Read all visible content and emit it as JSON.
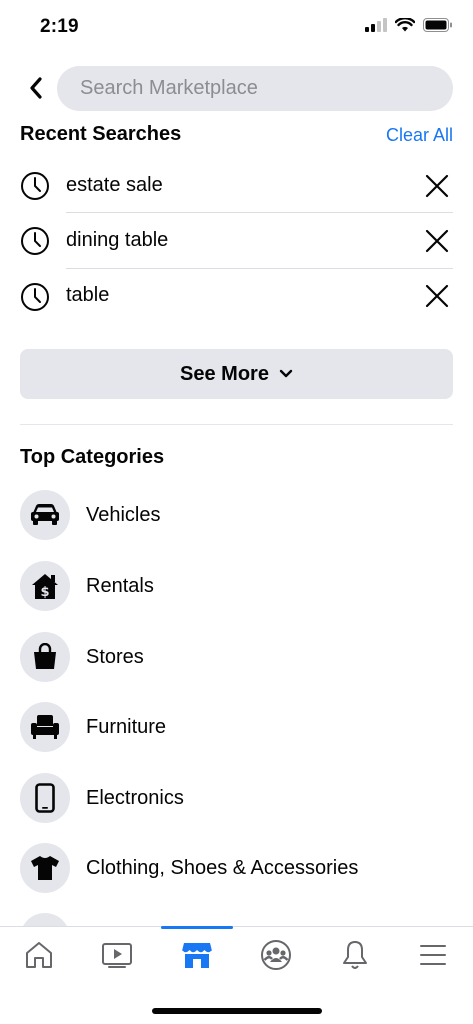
{
  "status_bar": {
    "time": "2:19"
  },
  "search": {
    "placeholder": "Search Marketplace"
  },
  "recent": {
    "title": "Recent Searches",
    "clear_label": "Clear All",
    "items": [
      {
        "label": "estate sale",
        "icon": "clock-icon"
      },
      {
        "label": "dining table",
        "icon": "clock-icon"
      },
      {
        "label": "table",
        "icon": "clock-icon"
      }
    ],
    "see_more_label": "See More"
  },
  "categories": {
    "title": "Top Categories",
    "items": [
      {
        "label": "Vehicles",
        "icon": "car-icon"
      },
      {
        "label": "Rentals",
        "icon": "house-dollar-icon"
      },
      {
        "label": "Stores",
        "icon": "shopping-bag-icon"
      },
      {
        "label": "Furniture",
        "icon": "armchair-icon"
      },
      {
        "label": "Electronics",
        "icon": "smartphone-icon"
      },
      {
        "label": "Clothing, Shoes & Accessories",
        "icon": "tshirt-icon"
      }
    ]
  },
  "bottom_nav": {
    "items": [
      "home-icon",
      "watch-icon",
      "marketplace-icon",
      "groups-icon",
      "bell-icon",
      "menu-icon"
    ],
    "active": "marketplace-icon"
  },
  "colors": {
    "accent": "#1877f2",
    "chip_bg": "#e4e6eb",
    "text": "#050505"
  }
}
